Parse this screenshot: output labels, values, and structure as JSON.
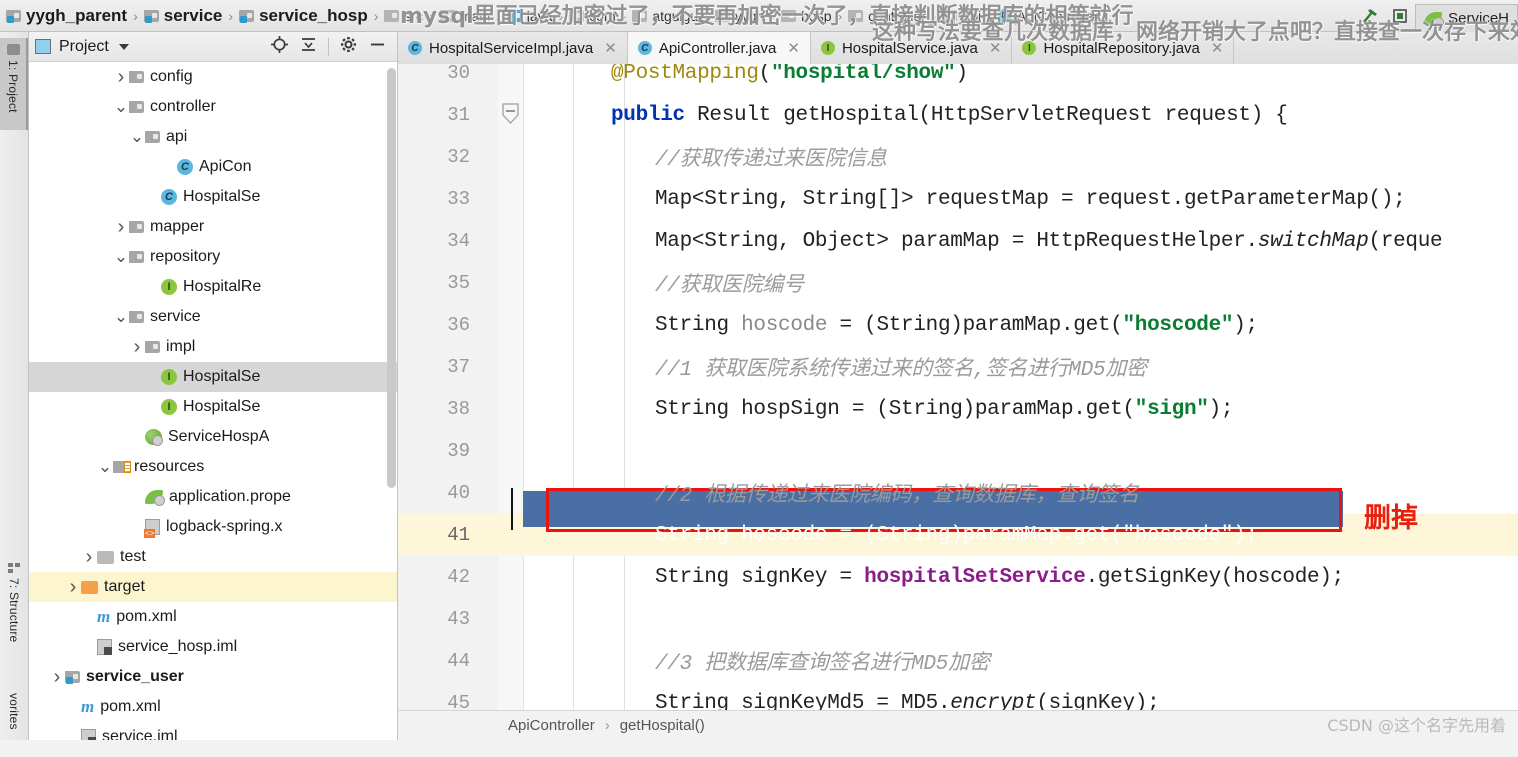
{
  "breadcrumb": {
    "items": [
      {
        "label": "yygh_parent",
        "icon": "module-folder-icon",
        "style": "bold"
      },
      {
        "label": "service",
        "icon": "module-folder-icon",
        "style": "bold"
      },
      {
        "label": "service_hosp",
        "icon": "module-folder-icon",
        "style": "bold"
      },
      {
        "label": "src",
        "icon": "folder-icon",
        "style": "small"
      },
      {
        "label": "main",
        "icon": "folder-icon",
        "style": "small"
      },
      {
        "label": "java",
        "icon": "source-folder-icon",
        "style": "small"
      },
      {
        "label": "com",
        "icon": "folder-icon",
        "style": "small"
      },
      {
        "label": "atguigu",
        "icon": "folder-icon",
        "style": "small"
      },
      {
        "label": "yygh",
        "icon": "folder-icon",
        "style": "small"
      },
      {
        "label": "hosp",
        "icon": "folder-icon",
        "style": "small"
      },
      {
        "label": "controller",
        "icon": "folder-icon",
        "style": "small"
      },
      {
        "label": "api",
        "icon": "folder-icon",
        "style": "small"
      },
      {
        "label": "ApiController",
        "icon": "class-icon",
        "style": "small"
      }
    ],
    "separator": "›"
  },
  "toolbar_right": {
    "run_config_label": "ServiceH"
  },
  "tool_strip": {
    "tabs": [
      {
        "label": "1: Project",
        "icon": "project-folder-icon",
        "active": true
      },
      {
        "label": "7: Structure",
        "icon": "structure-icon",
        "active": false
      },
      {
        "label": "vorites",
        "icon": "favorites-icon",
        "active": false
      }
    ]
  },
  "project_panel": {
    "title": "Project",
    "buttons": [
      {
        "name": "locate-icon",
        "glyph": "⊕"
      },
      {
        "name": "collapse-all-icon",
        "glyph": "⤒"
      },
      {
        "name": "settings-gear-icon",
        "glyph": "✲"
      },
      {
        "name": "hide-panel-icon",
        "glyph": "—"
      }
    ],
    "tree": [
      {
        "label": "config",
        "indent": 5,
        "arrow": "right",
        "icon": "folder-icon",
        "state": "normal"
      },
      {
        "label": "controller",
        "indent": 5,
        "arrow": "down",
        "icon": "folder-icon",
        "state": "normal"
      },
      {
        "label": "api",
        "indent": 6,
        "arrow": "down",
        "icon": "folder-icon",
        "state": "normal"
      },
      {
        "label": "ApiCon",
        "indent": 8,
        "arrow": "none",
        "icon": "class-icon",
        "state": "normal"
      },
      {
        "label": "HospitalSe",
        "indent": 7,
        "arrow": "none",
        "icon": "class-icon",
        "state": "normal"
      },
      {
        "label": "mapper",
        "indent": 5,
        "arrow": "right",
        "icon": "folder-icon",
        "state": "normal"
      },
      {
        "label": "repository",
        "indent": 5,
        "arrow": "down",
        "icon": "folder-icon",
        "state": "normal"
      },
      {
        "label": "HospitalRe",
        "indent": 7,
        "arrow": "none",
        "icon": "interface-icon",
        "state": "normal"
      },
      {
        "label": "service",
        "indent": 5,
        "arrow": "down",
        "icon": "folder-icon",
        "state": "normal"
      },
      {
        "label": "impl",
        "indent": 6,
        "arrow": "right",
        "icon": "folder-icon",
        "state": "normal"
      },
      {
        "label": "HospitalSe",
        "indent": 7,
        "arrow": "none",
        "icon": "interface-icon",
        "state": "selected"
      },
      {
        "label": "HospitalSe",
        "indent": 7,
        "arrow": "none",
        "icon": "interface-icon",
        "state": "normal"
      },
      {
        "label": "ServiceHospA",
        "indent": 6,
        "arrow": "none",
        "icon": "spring-boot-icon",
        "state": "normal"
      },
      {
        "label": "resources",
        "indent": 4,
        "arrow": "down",
        "icon": "resources-folder-icon",
        "state": "normal"
      },
      {
        "label": "application.prope",
        "indent": 6,
        "arrow": "none",
        "icon": "properties-icon",
        "state": "normal"
      },
      {
        "label": "logback-spring.x",
        "indent": 6,
        "arrow": "none",
        "icon": "xml-file-icon",
        "state": "normal"
      },
      {
        "label": "test",
        "indent": 3,
        "arrow": "right",
        "icon": "plain-folder-icon",
        "state": "normal"
      },
      {
        "label": "target",
        "indent": 2,
        "arrow": "right",
        "icon": "target-folder-icon",
        "state": "highlighted"
      },
      {
        "label": "pom.xml",
        "indent": 3,
        "arrow": "none",
        "icon": "maven-icon",
        "state": "normal"
      },
      {
        "label": "service_hosp.iml",
        "indent": 3,
        "arrow": "none",
        "icon": "iml-file-icon",
        "state": "normal"
      },
      {
        "label": "service_user",
        "indent": 1,
        "arrow": "right",
        "icon": "module-folder-icon",
        "state": "bold"
      },
      {
        "label": "pom.xml",
        "indent": 2,
        "arrow": "none",
        "icon": "maven-icon",
        "state": "normal"
      },
      {
        "label": "service.iml",
        "indent": 2,
        "arrow": "none",
        "icon": "iml-file-icon",
        "state": "normal"
      }
    ]
  },
  "editor": {
    "tabs": [
      {
        "label": "HospitalServiceImpl.java",
        "icon": "class-icon",
        "active": false,
        "close": "✕"
      },
      {
        "label": "ApiController.java",
        "icon": "class-icon",
        "active": true,
        "close": "✕"
      },
      {
        "label": "HospitalService.java",
        "icon": "interface-icon",
        "active": false,
        "close": "✕"
      },
      {
        "label": "HospitalRepository.java",
        "icon": "interface-icon",
        "active": false,
        "close": "✕"
      }
    ],
    "lines": [
      {
        "num": "30",
        "indent": 8,
        "html": "<span class=\"ann\">@PostMapping</span>(<span class=\"str\">\"hospital/show\"</span>)",
        "clipped_top": true
      },
      {
        "num": "31",
        "indent": 8,
        "html": "<span class=\"kw\">public</span> Result getHospital(HttpServletRequest request) {",
        "fold": true
      },
      {
        "num": "32",
        "indent": 12,
        "html": "<span class=\"cmt\">//获取传递过来医院信息</span>"
      },
      {
        "num": "33",
        "indent": 12,
        "html": "Map&lt;String, String[]&gt; requestMap = request.getParameterMap();"
      },
      {
        "num": "34",
        "indent": 12,
        "html": "Map&lt;String, Object&gt; paramMap = HttpRequestHelper.<span class=\"ital\">switchMap</span>(reque"
      },
      {
        "num": "35",
        "indent": 12,
        "html": "<span class=\"cmt\">//获取医院编号</span>"
      },
      {
        "num": "36",
        "indent": 12,
        "html": "String <span class=\"fld-s\">hoscode</span> = (String)paramMap.get(<span class=\"str\">\"hoscode\"</span>);"
      },
      {
        "num": "37",
        "indent": 12,
        "html": "<span class=\"cmt\">//1 获取医院系统传递过来的签名,签名进行MD5加密</span>"
      },
      {
        "num": "38",
        "indent": 12,
        "html": "String hospSign = (String)paramMap.get(<span class=\"str\">\"sign\"</span>);"
      },
      {
        "num": "39",
        "indent": 12,
        "html": ""
      },
      {
        "num": "40",
        "indent": 12,
        "html": "<span class=\"cmt\">//2 根据传递过来医院编码，查询数据库，查询签名</span>"
      },
      {
        "num": "41",
        "indent": 12,
        "html": "String hoscode = (String)paramMap.get(\"hoscode\");",
        "selected": true,
        "current": true
      },
      {
        "num": "42",
        "indent": 12,
        "html": "String signKey = <span class=\"fieldref\">hospitalSetService</span>.getSignKey(hoscode);"
      },
      {
        "num": "43",
        "indent": 12,
        "html": ""
      },
      {
        "num": "44",
        "indent": 12,
        "html": "<span class=\"cmt\">//3 把数据库查询签名进行MD5加密</span>"
      },
      {
        "num": "45",
        "indent": 12,
        "html": "String signKeyMd5 = MD5.<span class=\"ital\">encrypt</span>(signKey);"
      }
    ],
    "status_breadcrumb": [
      "ApiController",
      "getHospital()"
    ],
    "status_separator": "›"
  },
  "annotations": {
    "overlay_line1": "mysql里面已经加密过了，不要再加密一次了，直接判断数据库的相等就行",
    "overlay_line2": "这种写法要查几次数据库，网络开销大了点吧？直接查一次存下来效",
    "delete_note": "删掉",
    "delete_note_color": "#e8200f",
    "selection_color": "#4a6fa5",
    "highlight_box_color": "#ee1111"
  },
  "watermark": "CSDN @这个名字先用着"
}
